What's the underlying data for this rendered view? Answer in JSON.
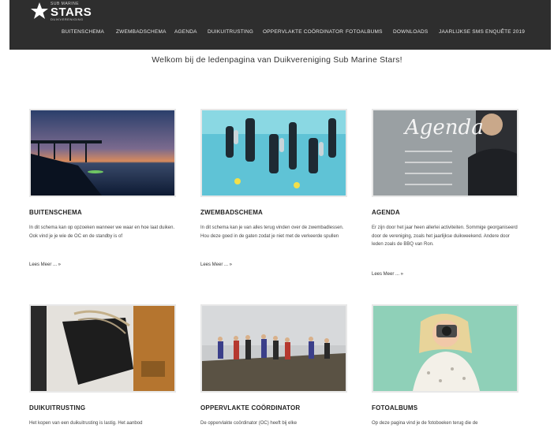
{
  "header": {
    "logo_line1": "SUB MARINE",
    "logo_line2": "STARS",
    "logo_line3": "DUIKVERENIGING",
    "nav": [
      "BUITENSCHEMA",
      "ZWEMBADSCHEMA",
      "AGENDA",
      "DUIKUITRUSTING",
      "OPPERVLAKTE COÖRDINATOR",
      "FOTOALBUMS",
      "DOWNLOADS",
      "JAARLIJKSE SMS ENQUÊTE 2019"
    ]
  },
  "welcome": "Welkom bij de ledenpagina van Duikvereniging Sub Marine Stars!",
  "cards": [
    {
      "title": "BUITENSCHEMA",
      "desc": "In dit schema kan op opzoeken wanneer we waar en hoe laat duiken. Ook vind je je wie de OC en de standby is of",
      "more": "Lees Meer ... »"
    },
    {
      "title": "ZWEMBADSCHEMA",
      "desc": "In dit schema kan je van alles terug vinden over de zwembadlessen. Hou deze goed in de gaten zodat je niet met de verkeerde spullen",
      "more": "Lees Meer ... »"
    },
    {
      "title": "AGENDA",
      "desc": "Er zijn door het jaar heen allerlei activiteiten. Sommige georganiseerd door de vereniging, zoals het jaarlijkse duikweekend. Andere door leden zoals de BBQ van Ron.",
      "more": "Lees Meer ... »"
    },
    {
      "title": "DUIKUITRUSTING",
      "desc": "Het kopen van een duikuitrusting is lastig. Het aanbod",
      "more": ""
    },
    {
      "title": "OPPERVLAKTE COÖRDINATOR",
      "desc": "De oppervlakte coördinator (OC) heeft bij elke",
      "more": ""
    },
    {
      "title": "FOTOALBUMS",
      "desc": "Op deze pagina vind je de fotoboeken terug die de",
      "more": ""
    }
  ],
  "agenda_board_text": "Agenda"
}
